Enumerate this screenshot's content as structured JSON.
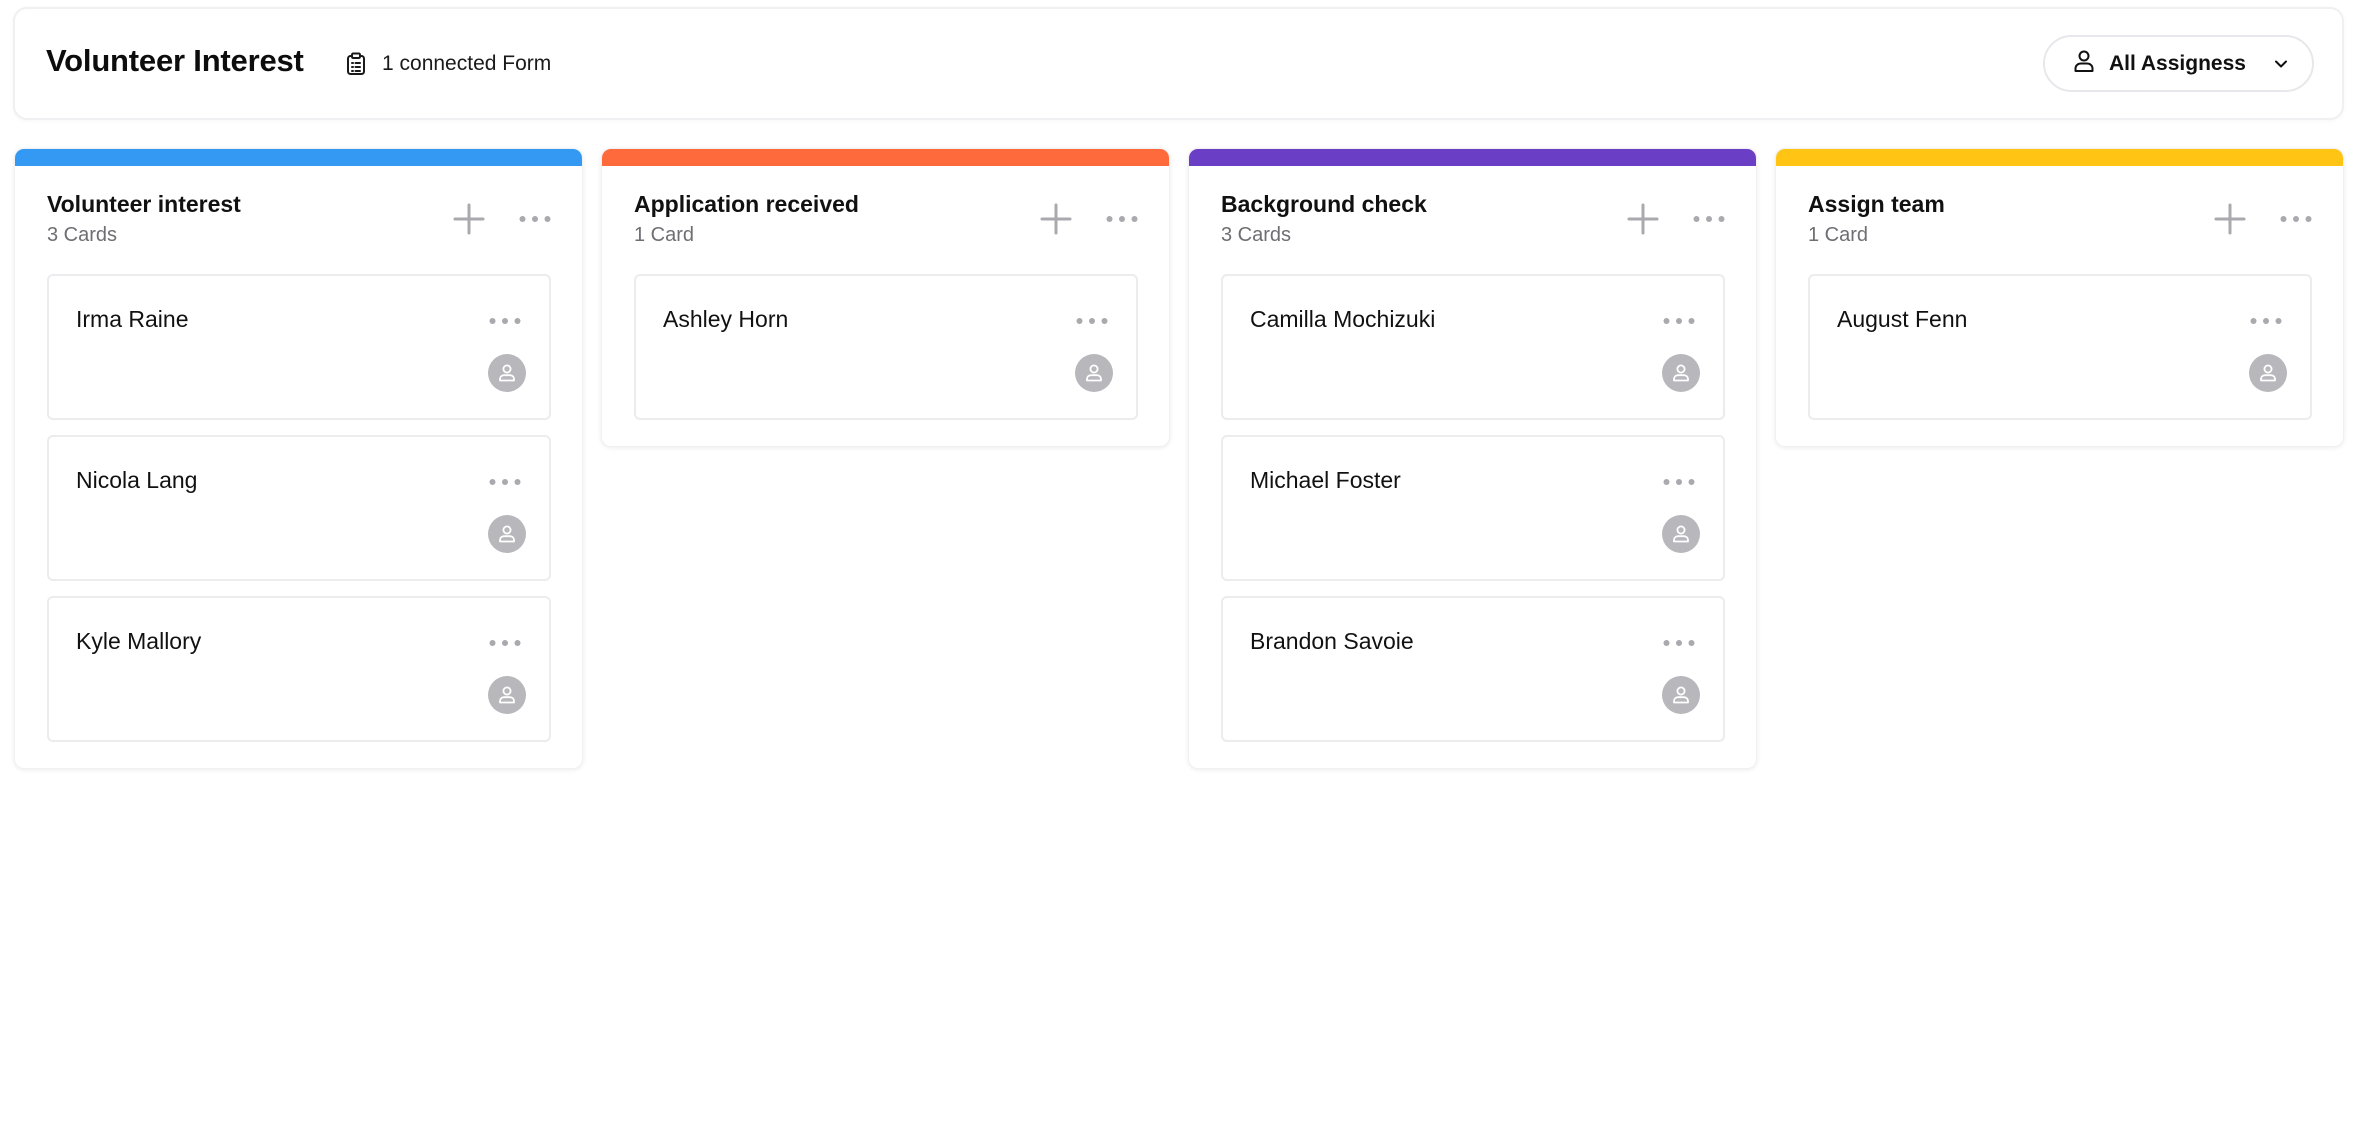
{
  "header": {
    "title": "Volunteer Interest",
    "form_link": "1 connected Form",
    "form_icon": "clipboard-icon",
    "assignees_label": "All Assigness",
    "assignees_icon": "person-icon"
  },
  "colors": {
    "volunteer_interest": "#3399f3",
    "application_received": "#ff6a3d",
    "background_check": "#6a3fc5",
    "assign_team": "#ffc414",
    "avatar": "#b7b7bc",
    "icon_gray": "#a9a9ae"
  },
  "columns": [
    {
      "title": "Volunteer interest",
      "count": "3 Cards",
      "color": "#3399f3",
      "cards": [
        {
          "name": "Irma Raine"
        },
        {
          "name": "Nicola Lang"
        },
        {
          "name": "Kyle Mallory"
        }
      ]
    },
    {
      "title": "Application received",
      "count": "1 Card",
      "color": "#ff6a3d",
      "cards": [
        {
          "name": "Ashley Horn"
        }
      ]
    },
    {
      "title": "Background check",
      "count": "3 Cards",
      "color": "#6a3fc5",
      "cards": [
        {
          "name": "Camilla Mochizuki"
        },
        {
          "name": "Michael Foster"
        },
        {
          "name": "Brandon Savoie"
        }
      ]
    },
    {
      "title": "Assign team",
      "count": "1 Card",
      "color": "#ffc414",
      "cards": [
        {
          "name": "August Fenn"
        }
      ]
    }
  ]
}
